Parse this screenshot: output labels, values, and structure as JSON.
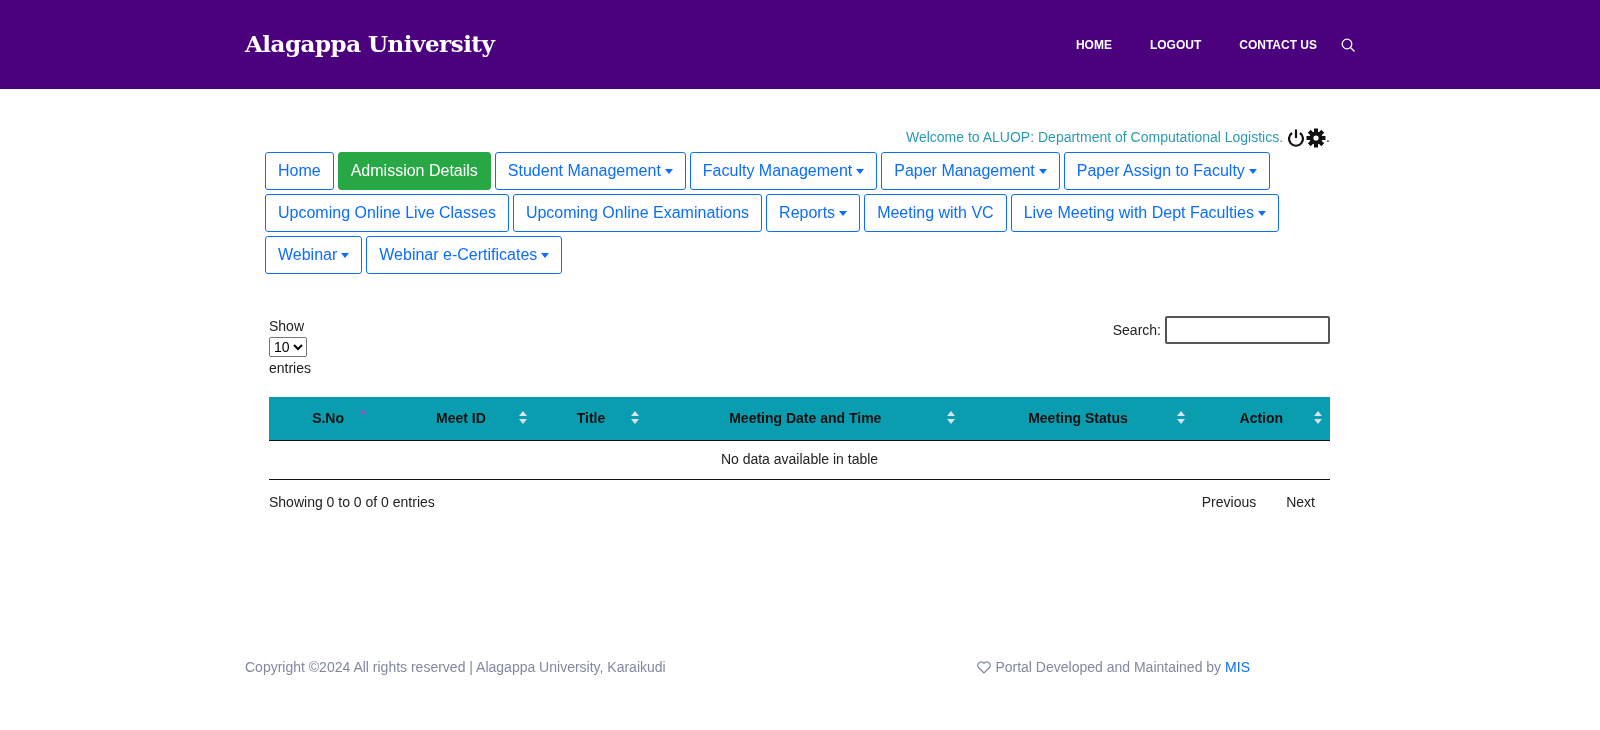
{
  "header": {
    "brand": "Alagappa University",
    "nav": [
      {
        "label": "HOME"
      },
      {
        "label": "LOGOUT"
      },
      {
        "label": "CONTACT US"
      }
    ]
  },
  "welcome": {
    "text": "Welcome to ALUOP: Department of Computational Logistics.",
    "suffix": "."
  },
  "menu": [
    {
      "label": "Home",
      "selected": false,
      "dropdown": false
    },
    {
      "label": "Admission Details",
      "selected": true,
      "dropdown": false
    },
    {
      "label": "Student Management",
      "selected": false,
      "dropdown": true
    },
    {
      "label": "Faculty Management",
      "selected": false,
      "dropdown": true
    },
    {
      "label": "Paper Management",
      "selected": false,
      "dropdown": true
    },
    {
      "label": "Paper Assign to Faculty",
      "selected": false,
      "dropdown": true
    },
    {
      "label": "Upcoming Online Live Classes",
      "selected": false,
      "dropdown": false
    },
    {
      "label": "Upcoming Online Examinations",
      "selected": false,
      "dropdown": false
    },
    {
      "label": "Reports",
      "selected": false,
      "dropdown": true
    },
    {
      "label": "Meeting with VC",
      "selected": false,
      "dropdown": false
    },
    {
      "label": "Live Meeting with Dept Faculties",
      "selected": false,
      "dropdown": true
    },
    {
      "label": "Webinar",
      "selected": false,
      "dropdown": true
    },
    {
      "label": "Webinar e-Certificates",
      "selected": false,
      "dropdown": true
    }
  ],
  "table_controls": {
    "show_label": "Show",
    "page_size": "10",
    "entries_label": "entries",
    "search_label": "Search:"
  },
  "table": {
    "columns": [
      {
        "label": "S.No",
        "sorted": true
      },
      {
        "label": "Meet ID",
        "sorted": false
      },
      {
        "label": "Title",
        "sorted": false
      },
      {
        "label": "Meeting Date and Time",
        "sorted": false
      },
      {
        "label": "Meeting Status",
        "sorted": false
      },
      {
        "label": "Action",
        "sorted": false
      }
    ],
    "empty_message": "No data available in table"
  },
  "table_footer": {
    "info": "Showing 0 to 0 of 0 entries",
    "pagination": [
      {
        "label": "Previous"
      },
      {
        "label": "Next"
      }
    ]
  },
  "footer": {
    "copyright": "Copyright ©2024 All rights reserved | Alagappa University, Karaikudi",
    "credit": "Portal Developed and Maintained by",
    "credit_link": "MIS"
  }
}
